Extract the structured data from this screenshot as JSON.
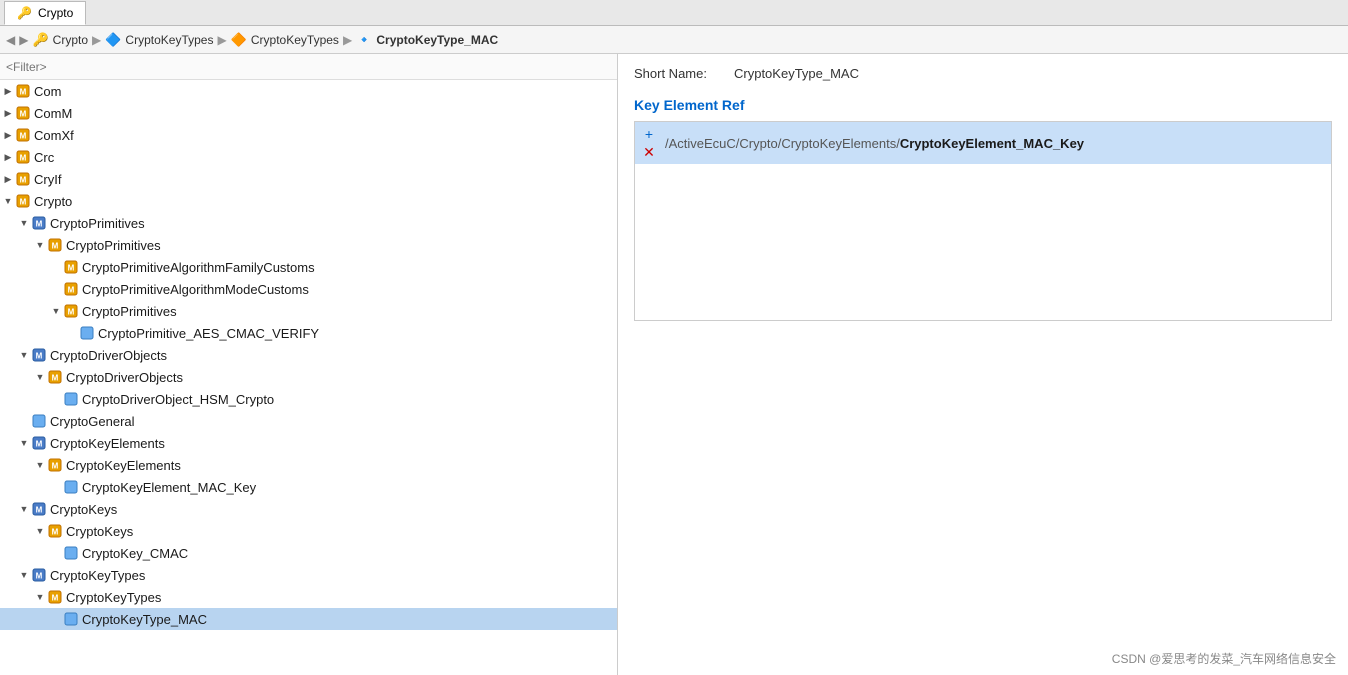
{
  "tab": {
    "label": "Crypto",
    "icon": "🔑"
  },
  "breadcrumb": {
    "items": [
      {
        "label": "Crypto",
        "icon": "🔑"
      },
      {
        "label": "CryptoKeyTypes",
        "icon": "🔷"
      },
      {
        "label": "CryptoKeyTypes",
        "icon": "🔶"
      },
      {
        "label": "CryptoKeyType_MAC",
        "icon": "🔹"
      }
    ],
    "separator": "▶"
  },
  "filter": {
    "placeholder": "<Filter>"
  },
  "tree": {
    "items": [
      {
        "id": 1,
        "level": 0,
        "toggle": "▶",
        "icon": "orange-module",
        "label": "Com",
        "selected": false
      },
      {
        "id": 2,
        "level": 0,
        "toggle": "▶",
        "icon": "orange-module",
        "label": "ComM",
        "selected": false
      },
      {
        "id": 3,
        "level": 0,
        "toggle": "▶",
        "icon": "orange-module",
        "label": "ComXf",
        "selected": false
      },
      {
        "id": 4,
        "level": 0,
        "toggle": "▶",
        "icon": "orange-module",
        "label": "Crc",
        "selected": false
      },
      {
        "id": 5,
        "level": 0,
        "toggle": "▶",
        "icon": "orange-module",
        "label": "CryIf",
        "selected": false
      },
      {
        "id": 6,
        "level": 0,
        "toggle": "▼",
        "icon": "orange-module",
        "label": "Crypto",
        "selected": false
      },
      {
        "id": 7,
        "level": 1,
        "toggle": "▼",
        "icon": "blue-container",
        "label": "CryptoPrimitives",
        "selected": false
      },
      {
        "id": 8,
        "level": 2,
        "toggle": "▼",
        "icon": "orange-container",
        "label": "CryptoPrimitives",
        "selected": false
      },
      {
        "id": 9,
        "level": 3,
        "toggle": "",
        "icon": "orange-item",
        "label": "CryptoPrimitiveAlgorithmFamilyCustoms",
        "selected": false
      },
      {
        "id": 10,
        "level": 3,
        "toggle": "",
        "icon": "orange-item",
        "label": "CryptoPrimitiveAlgorithmModeCustoms",
        "selected": false
      },
      {
        "id": 11,
        "level": 3,
        "toggle": "▼",
        "icon": "orange-container",
        "label": "CryptoPrimitives",
        "selected": false
      },
      {
        "id": 12,
        "level": 4,
        "toggle": "",
        "icon": "blue-item",
        "label": "CryptoPrimitive_AES_CMAC_VERIFY",
        "selected": false
      },
      {
        "id": 13,
        "level": 1,
        "toggle": "▼",
        "icon": "blue-container",
        "label": "CryptoDriverObjects",
        "selected": false
      },
      {
        "id": 14,
        "level": 2,
        "toggle": "▼",
        "icon": "orange-container",
        "label": "CryptoDriverObjects",
        "selected": false
      },
      {
        "id": 15,
        "level": 3,
        "toggle": "",
        "icon": "blue-item",
        "label": "CryptoDriverObject_HSM_Crypto",
        "selected": false
      },
      {
        "id": 16,
        "level": 1,
        "toggle": "",
        "icon": "blue-item",
        "label": "CryptoGeneral",
        "selected": false
      },
      {
        "id": 17,
        "level": 1,
        "toggle": "▼",
        "icon": "blue-container",
        "label": "CryptoKeyElements",
        "selected": false
      },
      {
        "id": 18,
        "level": 2,
        "toggle": "▼",
        "icon": "orange-container",
        "label": "CryptoKeyElements",
        "selected": false
      },
      {
        "id": 19,
        "level": 3,
        "toggle": "",
        "icon": "blue-item",
        "label": "CryptoKeyElement_MAC_Key",
        "selected": false
      },
      {
        "id": 20,
        "level": 1,
        "toggle": "▼",
        "icon": "blue-container",
        "label": "CryptoKeys",
        "selected": false
      },
      {
        "id": 21,
        "level": 2,
        "toggle": "▼",
        "icon": "orange-container",
        "label": "CryptoKeys",
        "selected": false
      },
      {
        "id": 22,
        "level": 3,
        "toggle": "",
        "icon": "blue-item",
        "label": "CryptoKey_CMAC",
        "selected": false
      },
      {
        "id": 23,
        "level": 1,
        "toggle": "▼",
        "icon": "blue-container",
        "label": "CryptoKeyTypes",
        "selected": false
      },
      {
        "id": 24,
        "level": 2,
        "toggle": "▼",
        "icon": "orange-container",
        "label": "CryptoKeyTypes",
        "selected": false
      },
      {
        "id": 25,
        "level": 3,
        "toggle": "",
        "icon": "blue-item",
        "label": "CryptoKeyType_MAC",
        "selected": true
      }
    ]
  },
  "right_panel": {
    "short_name_label": "Short Name:",
    "short_name_value": "CryptoKeyType_MAC",
    "section_title": "Key Element Ref",
    "key_element_ref": {
      "path_normal": "/ActiveEcuC/Crypto/CryptoKeyElements/",
      "path_bold": "CryptoKeyElement_MAC_Key"
    },
    "add_icon": "+",
    "del_icon": "✕"
  },
  "watermark": "CSDN @爱思考的发菜_汽车网络信息安全"
}
